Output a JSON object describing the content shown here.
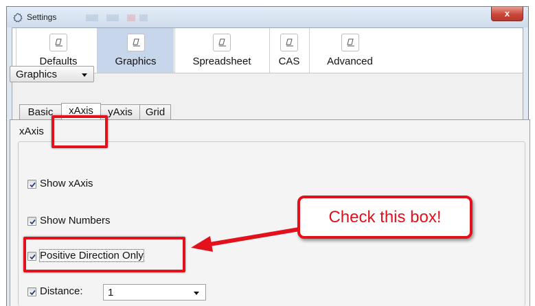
{
  "window": {
    "title": "Settings",
    "close_label": "x"
  },
  "categories": [
    {
      "label": "Defaults",
      "selected": false
    },
    {
      "label": "Graphics",
      "selected": true
    },
    {
      "label": "Spreadsheet",
      "selected": false
    },
    {
      "label": "CAS",
      "selected": false
    },
    {
      "label": "Advanced",
      "selected": false
    }
  ],
  "view_select": {
    "value": "Graphics"
  },
  "subtabs": [
    {
      "label": "Basic",
      "active": false
    },
    {
      "label": "xAxis",
      "active": true
    },
    {
      "label": "yAxis",
      "active": false
    },
    {
      "label": "Grid",
      "active": false
    }
  ],
  "axis_group": {
    "title": "xAxis",
    "show_axis": {
      "label": "Show xAxis",
      "checked": true
    },
    "show_numbers": {
      "label": "Show Numbers",
      "checked": true
    },
    "positive_only": {
      "label": "Positive Direction Only",
      "checked": true
    },
    "distance": {
      "label": "Distance:",
      "checked": true,
      "value": "1"
    }
  },
  "annotation": {
    "callout_text": "Check this box!",
    "highlight_color": "#e3111b"
  },
  "colors": {
    "selected_category_bg": "#c7d6ea",
    "close_button": "#c9463a"
  }
}
